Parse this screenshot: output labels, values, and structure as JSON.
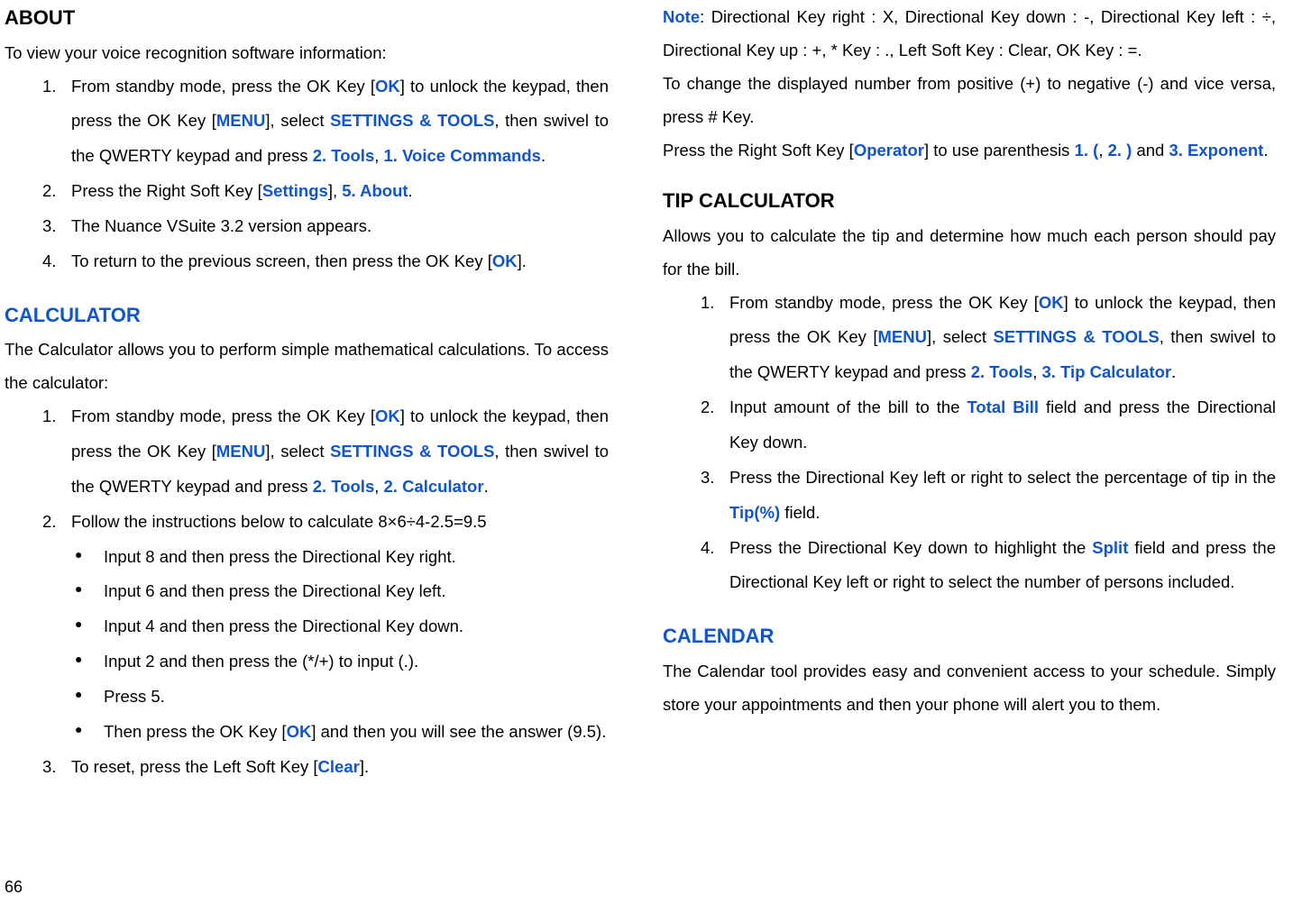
{
  "left": {
    "aboutHeading": "ABOUT",
    "aboutIntro": "To view your voice recognition software information:",
    "aboutList": {
      "n1": "1.",
      "i1_pre": "From standby mode, press the OK Key [",
      "i1_ok": "OK",
      "i1_mid1": "] to unlock the keypad, then press the OK Key [",
      "i1_menu": "MENU",
      "i1_mid2": "], select ",
      "i1_settings": "SETTINGS & TOOLS",
      "i1_mid3": ", then swivel to the QWERTY keypad and press ",
      "i1_tools": "2. Tools",
      "i1_comma": ", ",
      "i1_voice": "1. Voice Commands",
      "i1_end": ".",
      "n2": "2.",
      "i2_pre": "Press the Right Soft Key [",
      "i2_settings": "Settings",
      "i2_mid": "], ",
      "i2_about": "5. About",
      "i2_end": ".",
      "n3": "3.",
      "i3": "The Nuance VSuite 3.2 version appears.",
      "n4": "4.",
      "i4_pre": "To return to the previous screen, then press the OK Key [",
      "i4_ok": "OK",
      "i4_end": "]."
    },
    "calcHeading": "CALCULATOR",
    "calcIntro": "The Calculator allows you to perform simple mathematical calculations. To access the calculator:",
    "calcList": {
      "n1": "1.",
      "i1_pre": "From standby mode, press the OK Key [",
      "i1_ok": "OK",
      "i1_mid1": "] to unlock the keypad, then press the OK Key [",
      "i1_menu": "MENU",
      "i1_mid2": "], select ",
      "i1_settings": "SETTINGS & TOOLS",
      "i1_mid3": ", then swivel to the QWERTY keypad and press ",
      "i1_tools": "2. Tools",
      "i1_comma": ", ",
      "i1_calc": "2. Calculator",
      "i1_end": ".",
      "n2": "2.",
      "i2": "Follow the instructions below to calculate 8×6÷4-2.5=9.5",
      "b1": "Input 8 and then press the Directional Key right.",
      "b2": "Input 6 and then press the Directional Key left.",
      "b3": "Input 4 and then press the Directional Key down.",
      "b4": "Input 2 and then press the (*/+) to input (.).",
      "b5": "Press 5.",
      "b6_pre": "Then press the OK Key [",
      "b6_ok": "OK",
      "b6_end": "] and then you will see the answer (9.5).",
      "n3": "3.",
      "i3_pre": "To reset, press the Left Soft Key [",
      "i3_clear": "Clear",
      "i3_end": "]."
    }
  },
  "right": {
    "note_label": "Note",
    "note_text": ": Directional Key right : X, Directional Key down : -,  Directional Key left : ÷, Directional Key up : +, * Key : ., Left Soft Key : Clear, OK Key : =.",
    "changeSign": "To change the displayed number from positive (+) to negative (-) and vice versa, press # Key.",
    "op_pre": "Press the Right Soft Key [",
    "op_operator": "Operator",
    "op_mid": "] to use parenthesis ",
    "op_1": "1. (",
    "op_comma": ", ",
    "op_2": "2. )",
    "op_and": " and ",
    "op_3": "3. Exponent",
    "op_end": ".",
    "tipHeading": "TIP CALCULATOR",
    "tipIntro": "Allows you to calculate the tip and determine how much each person should pay for the bill.",
    "tipList": {
      "n1": "1.",
      "i1_pre": "From standby mode, press the OK Key [",
      "i1_ok": "OK",
      "i1_mid1": "] to unlock the keypad, then press the OK Key [",
      "i1_menu": "MENU",
      "i1_mid2": "], select ",
      "i1_settings": "SETTINGS & TOOLS",
      "i1_mid3": ", then swivel to the QWERTY keypad and press ",
      "i1_tools": "2. Tools",
      "i1_comma": ", ",
      "i1_tip": "3. Tip Calculator",
      "i1_end": ".",
      "n2": "2.",
      "i2_pre": "Input amount of the bill to the ",
      "i2_total": "Total Bill",
      "i2_end": " field and press the Directional Key down.",
      "n3": "3.",
      "i3_pre": "Press the Directional Key left or right to select the percentage of tip in the ",
      "i3_tip": "Tip(%)",
      "i3_end": " field.",
      "n4": "4.",
      "i4_pre": "Press the Directional Key down to highlight the ",
      "i4_split": "Split",
      "i4_end": " field and press the Directional Key left or right to select the number of persons included."
    },
    "calendarHeading": "CALENDAR",
    "calendarText": "The Calendar tool provides easy and convenient access to your schedule. Simply store your appointments and then your phone will alert you to them."
  },
  "pageNumber": "66"
}
